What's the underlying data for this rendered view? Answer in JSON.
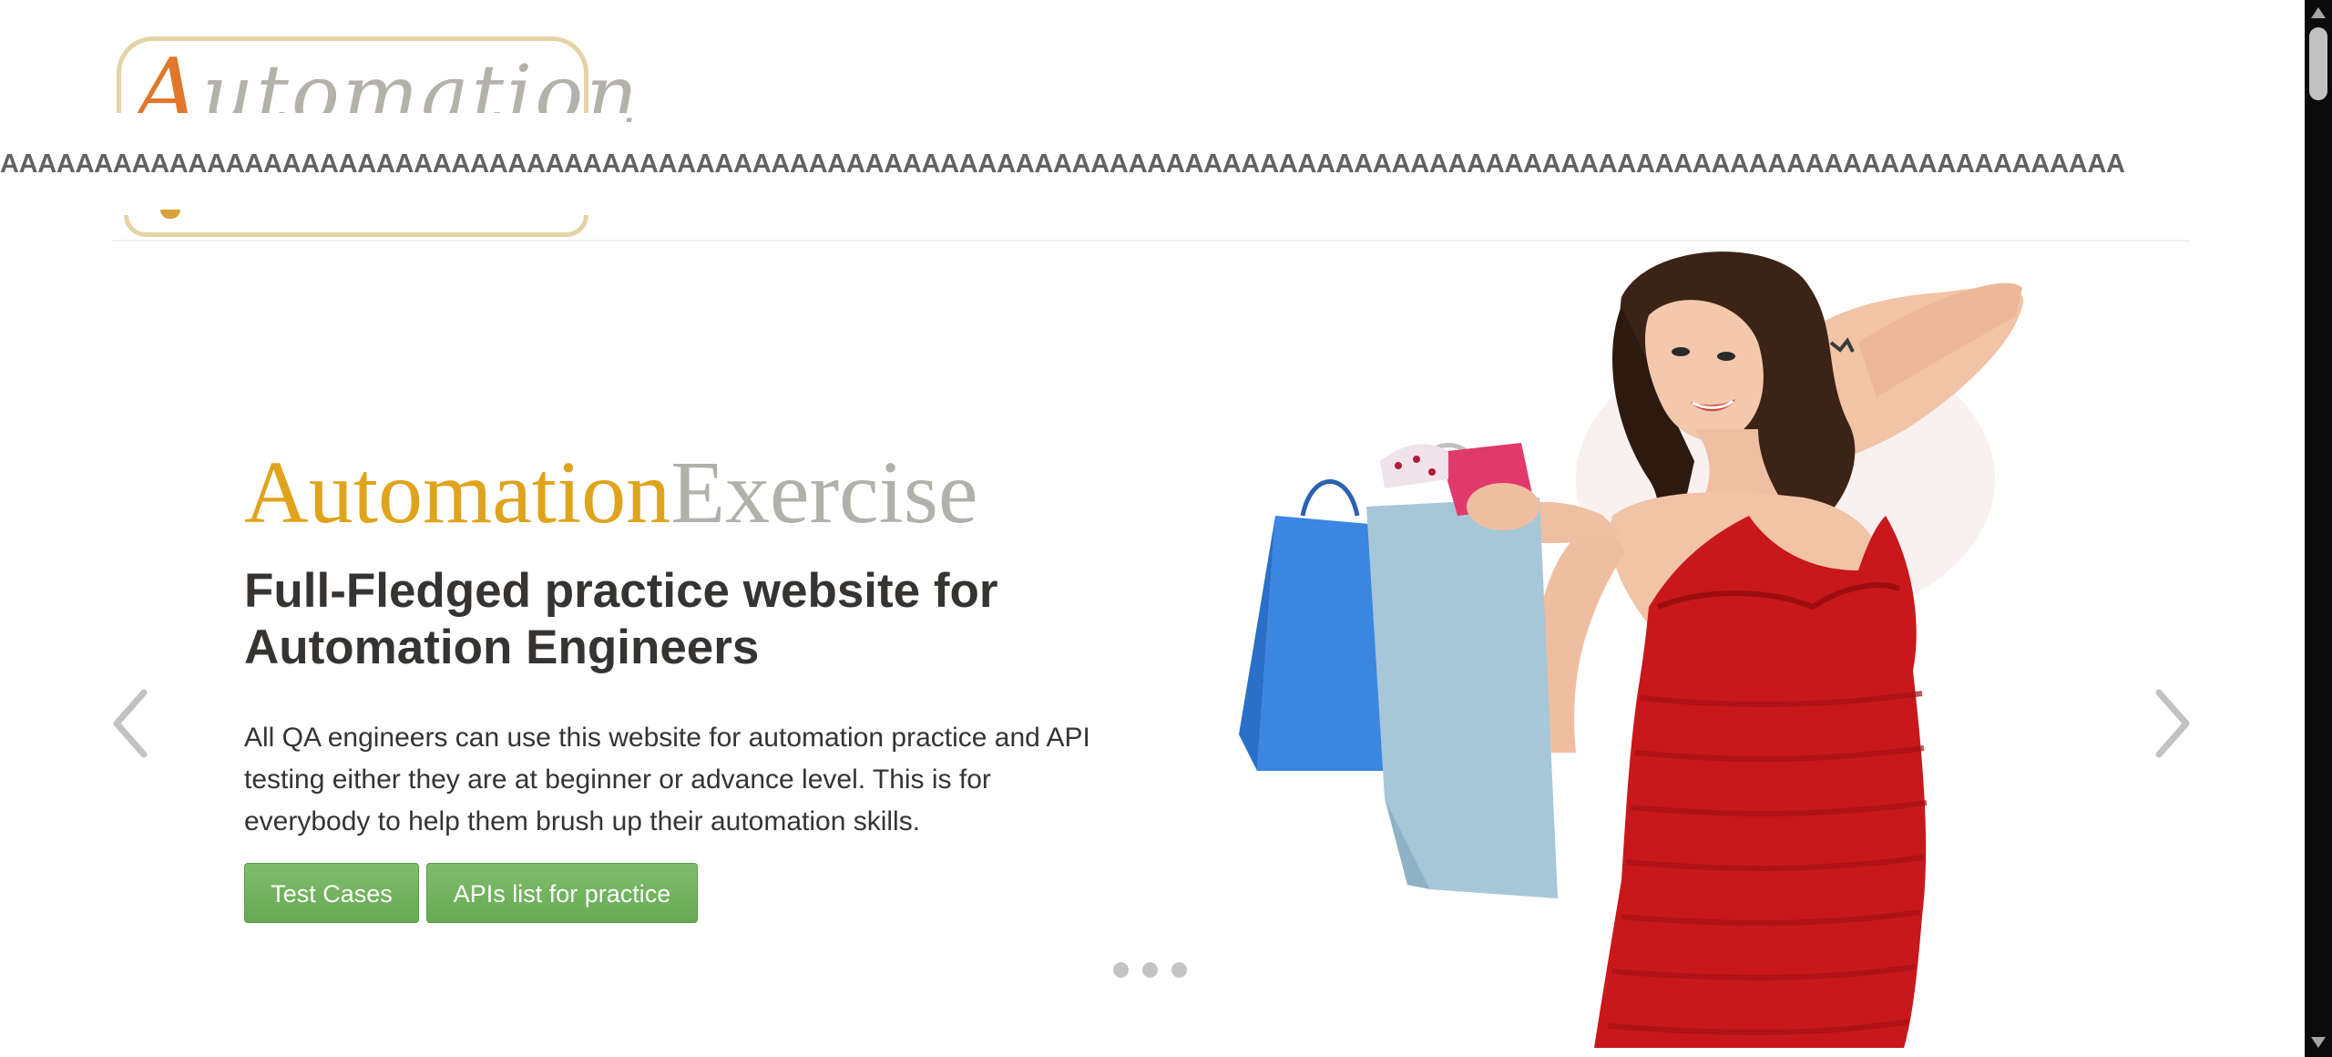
{
  "header": {
    "logo": {
      "first_letter": "A",
      "rest": "utomation"
    },
    "banner_strip": "AAAAAAAAAAAAAAAAAAAAAAAAAAAAAAAAAAAAAAAAAAAAAAAAAAAAAAAAAAAAAAAAAAAAAAAAAAAAAAAAAAAAAAAAAAAAAAAAAAAAAAAAAAAAAAAAA"
  },
  "slider": {
    "brand_part_1": "Automation",
    "brand_part_2": "Exercise",
    "heading": "Full-Fledged practice website for Automation Engineers",
    "description": "All QA engineers can use this website for automation practice and API testing either they are at beginner or advance level. This is for everybody to help them brush up their automation skills.",
    "buttons": {
      "test_cases": "Test Cases",
      "apis_list": "APIs list for practice"
    },
    "indicators": 3,
    "active_indicator": 1,
    "prev_icon": "chevron-left-icon",
    "next_icon": "chevron-right-icon"
  },
  "colors": {
    "brand_orange": "#e0a31c",
    "brand_gray": "#b1b1ac",
    "button_green": "#6bb05b",
    "text_dark": "#363432",
    "dress_red": "#c8181b"
  }
}
